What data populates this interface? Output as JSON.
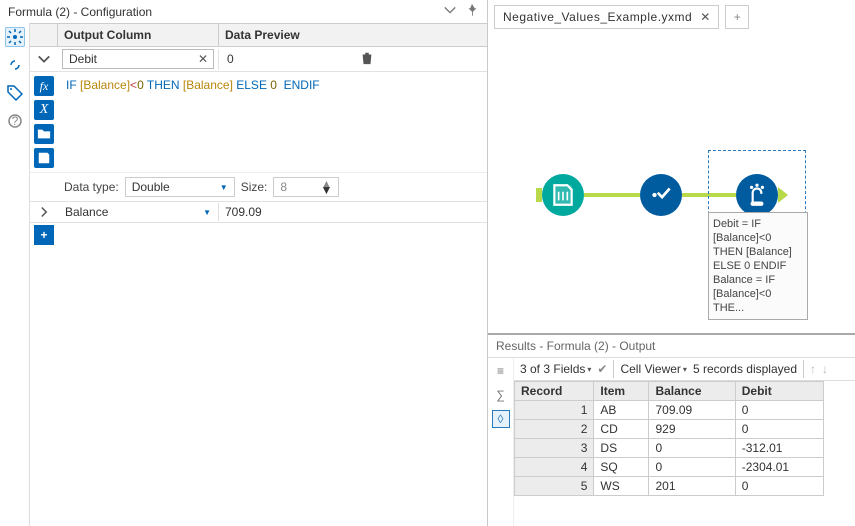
{
  "left_panel": {
    "title": "Formula (2) - Configuration",
    "headers": {
      "output_column": "Output Column",
      "data_preview": "Data Preview"
    },
    "active_field": {
      "name": "Debit",
      "preview": "0"
    },
    "formula_tokens": [
      "IF ",
      "[Balance]",
      "<",
      "0",
      " THEN ",
      "[Balance]",
      " ELSE ",
      "0",
      "  ENDIF"
    ],
    "data_type": {
      "label": "Data type:",
      "value": "Double",
      "size_label": "Size:",
      "size_value": "8"
    },
    "collapsed_field": {
      "name": "Balance",
      "preview": "709.09"
    }
  },
  "tabs": {
    "active": "Negative_Values_Example.yxmd"
  },
  "canvas": {
    "annotation": "Debit = IF [Balance]<0 THEN  [Balance] ELSE 0  ENDIF\nBalance = IF [Balance]<0 THE..."
  },
  "results": {
    "title": "Results - Formula (2) - Output",
    "fields_summary": "3 of 3 Fields",
    "cell_viewer": "Cell Viewer",
    "records_summary": "5 records displayed",
    "columns": [
      "Record",
      "Item",
      "Balance",
      "Debit"
    ],
    "rows": [
      {
        "record": "1",
        "item": "AB",
        "balance": "709.09",
        "debit": "0"
      },
      {
        "record": "2",
        "item": "CD",
        "balance": "929",
        "debit": "0"
      },
      {
        "record": "3",
        "item": "DS",
        "balance": "0",
        "debit": "-312.01"
      },
      {
        "record": "4",
        "item": "SQ",
        "balance": "0",
        "debit": "-2304.01"
      },
      {
        "record": "5",
        "item": "WS",
        "balance": "201",
        "debit": "0"
      }
    ]
  },
  "chart_data": {
    "type": "table",
    "title": "Results - Formula (2) - Output",
    "columns": [
      "Record",
      "Item",
      "Balance",
      "Debit"
    ],
    "rows": [
      [
        1,
        "AB",
        709.09,
        0
      ],
      [
        2,
        "CD",
        929,
        0
      ],
      [
        3,
        "DS",
        0,
        -312.01
      ],
      [
        4,
        "SQ",
        0,
        -2304.01
      ],
      [
        5,
        "WS",
        201,
        0
      ]
    ]
  }
}
